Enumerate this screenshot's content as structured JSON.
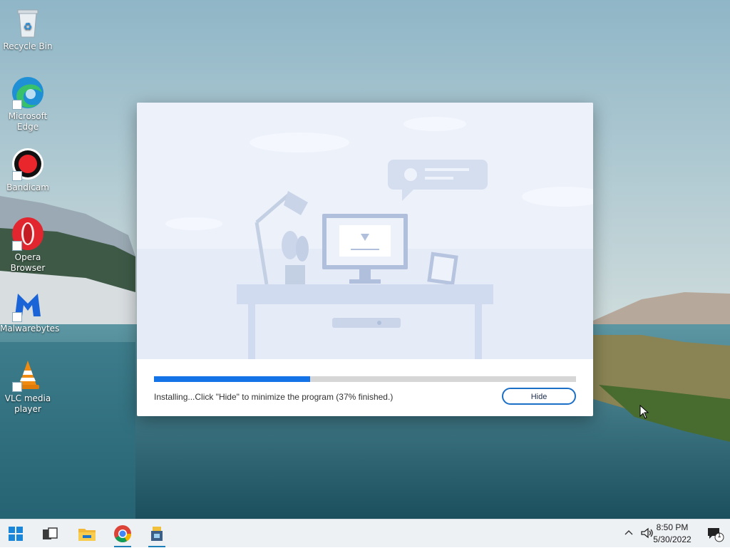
{
  "desktop": {
    "icons": [
      {
        "label": "Recycle Bin",
        "icon": "recycle-bin-icon"
      },
      {
        "label": "Microsoft Edge",
        "icon": "edge-icon"
      },
      {
        "label": "Bandicam",
        "icon": "bandicam-icon"
      },
      {
        "label": "Opera Browser",
        "icon": "opera-icon"
      },
      {
        "label": "Malwarebytes",
        "icon": "malwarebytes-icon"
      },
      {
        "label": "VLC media player",
        "icon": "vlc-icon"
      }
    ]
  },
  "installer": {
    "progress_fraction": 0.37,
    "status": "Installing...Click \"Hide\" to minimize the program (37% finished.)",
    "hide_label": "Hide"
  },
  "taskbar": {
    "items": [
      "start-icon",
      "task-view-icon",
      "file-explorer-icon",
      "chrome-icon",
      "installer-app-icon"
    ],
    "clock_time": "8:50 PM",
    "clock_date": "5/30/2022",
    "notification_count": "1"
  },
  "colors": {
    "accent": "#1473e6",
    "progress_track": "#d6d6d6",
    "taskbar": "#eef1f4"
  }
}
